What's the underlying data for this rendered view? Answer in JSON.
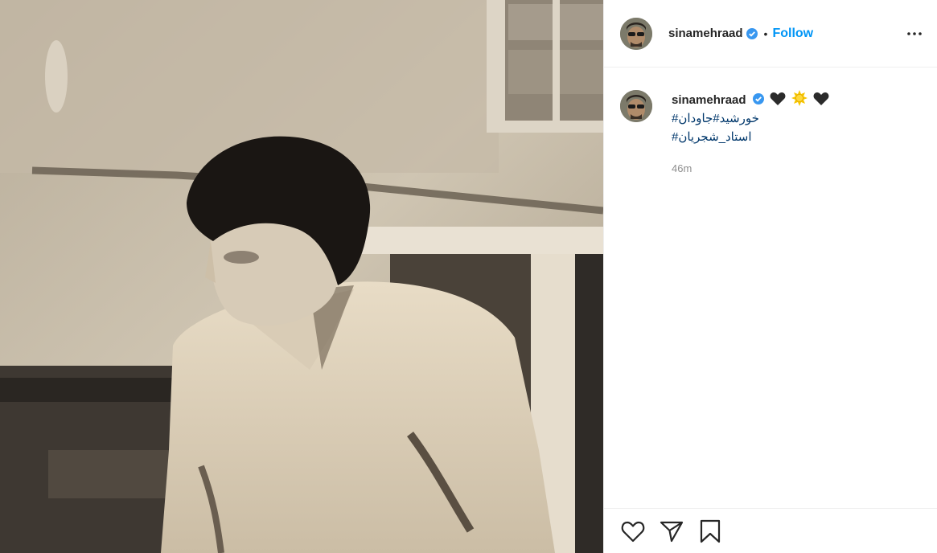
{
  "post": {
    "username": "sinamehraad",
    "verified": true,
    "follow_label": "Follow",
    "separator": "•",
    "caption_emojis": [
      "black-heart",
      "sun",
      "black-heart"
    ],
    "hashtags": [
      "#خورشید#جاودان",
      "#استاد_شجریان"
    ],
    "time": "46m"
  },
  "colors": {
    "accent": "#0095f6",
    "hashtag": "#00376b",
    "muted": "#8e8e8e",
    "border": "#efefef"
  },
  "icons": {
    "header_more": "more-horizontal-icon",
    "verified": "verified-badge-icon",
    "like": "heart-icon",
    "share": "paper-plane-icon",
    "save": "bookmark-icon"
  }
}
